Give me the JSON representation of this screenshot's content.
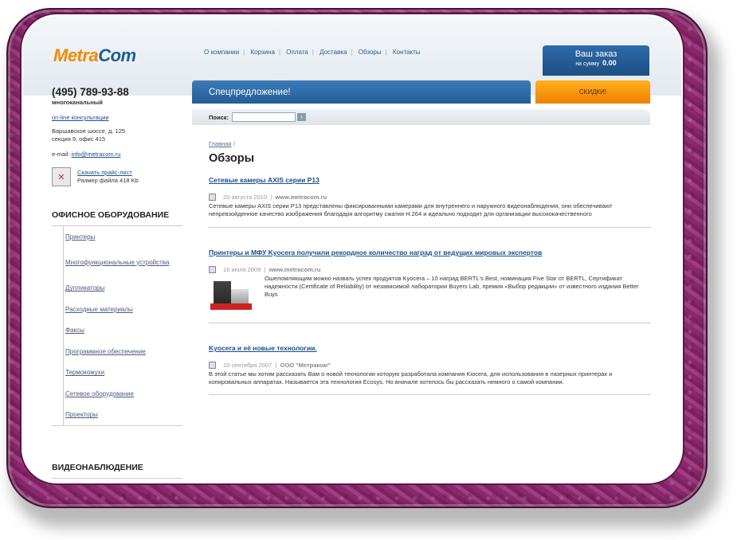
{
  "logo": {
    "part1": "Metra",
    "part2": "Com"
  },
  "nav": [
    "О компании",
    "Корзина",
    "Оплата",
    "Доставка",
    "Обзоры",
    "Контакты"
  ],
  "cart": {
    "title": "Ваш заказ",
    "sum_label": "на сумму",
    "sum_value": "0.00"
  },
  "contact": {
    "phone": "(495) 789-93-88",
    "phone_note": "многоканальный",
    "online": "on-line консультации",
    "address": [
      "Варшавское шоссе, д. 125",
      "секция 9, офис 415"
    ],
    "email_label": "e-mail:",
    "email": "info@metracom.ru",
    "price_link": "Скачать прайс-лист",
    "price_size": "Размер файла 418 Kb"
  },
  "sidebar": {
    "section1": "ОФИСНОЕ ОБОРУДОВАНИЕ",
    "items": [
      "Принтеры",
      "Многофункциональные устройства",
      "Дупликаторы",
      "Расходные материалы",
      "Факсы",
      "Программное обеспечение",
      "Термокожухи",
      "Сетевое оборудование",
      "Проекторы"
    ],
    "section2": "ВИДЕОНАБЛЮДЕНИЕ"
  },
  "banner": {
    "special": "Спецпредложение!",
    "sale": "СКИДКИ!"
  },
  "search": {
    "label": "Поиск:",
    "placeholder": ""
  },
  "breadcrumb": {
    "home": "Главная",
    "sep": "/"
  },
  "page_title": "Обзоры",
  "articles": [
    {
      "title": "Сетевые камеры AXIS серии P13",
      "date": "20 августа 2010",
      "source": "www.metracom.ru",
      "text": "Сетевые камеры AXIS серии P13 представлены фиксированными камерами для внутреннего и наружного видеонаблюдения, они обеспечивают непревзойденное качество изображения благодаря алгоритму сжатия H.264 и идеально подходят для организации высококачественного"
    },
    {
      "title": "Принтеры и МФУ Kyocera получили рекордное количество наград от ведущих мировых экспертов",
      "date": "16 июля 2009",
      "source": "www.metracom.ru",
      "text": "Ошеломляющим можно назвать успех продуктов Kyocera – 10 наград BERTL's Best, номинация Five Star от BERTL, Сертификат надежности (Certificate of Reliability) от независимой лаборатории Buyers Lab, премия «Выбор редакции» от известного издания Better Buys"
    },
    {
      "title": "Kyocera и её новые технологии.",
      "date": "10 сентября 2007",
      "source": "ООО \"Метраком\"",
      "text": "В этой статье мы хотим рассказать Вам о новой технологии которую разработала компания Kiocera, для использования в лазерных принтерах и копировальных аппаратах. Называется эта технология Ecosys. Но вначале хотелось бы рассказать немного о самой компании."
    }
  ]
}
